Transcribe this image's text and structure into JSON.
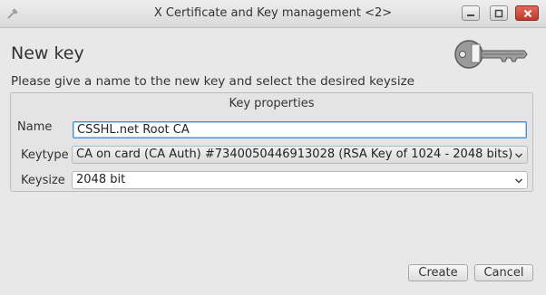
{
  "window": {
    "title": "X Certificate and Key management <2>",
    "controls": {
      "minimize": "minimize-icon",
      "maximize": "maximize-icon",
      "close": "close-icon"
    }
  },
  "header": {
    "heading": "New key",
    "instruction": "Please give a name to the new key and select the desired keysize"
  },
  "group": {
    "title": "Key properties",
    "name_label": "Name",
    "name_value": "CSSHL.net Root CA",
    "keytype_label": "Keytype",
    "keytype_value": "CA on card (CA Auth) #7340050446913028 (RSA Key of 1024 - 2048 bits)",
    "keysize_label": "Keysize",
    "keysize_value": "2048 bit"
  },
  "buttons": {
    "create": "Create",
    "cancel": "Cancel"
  },
  "colors": {
    "accent": "#4a90d9",
    "close_button": "#c0392b"
  }
}
